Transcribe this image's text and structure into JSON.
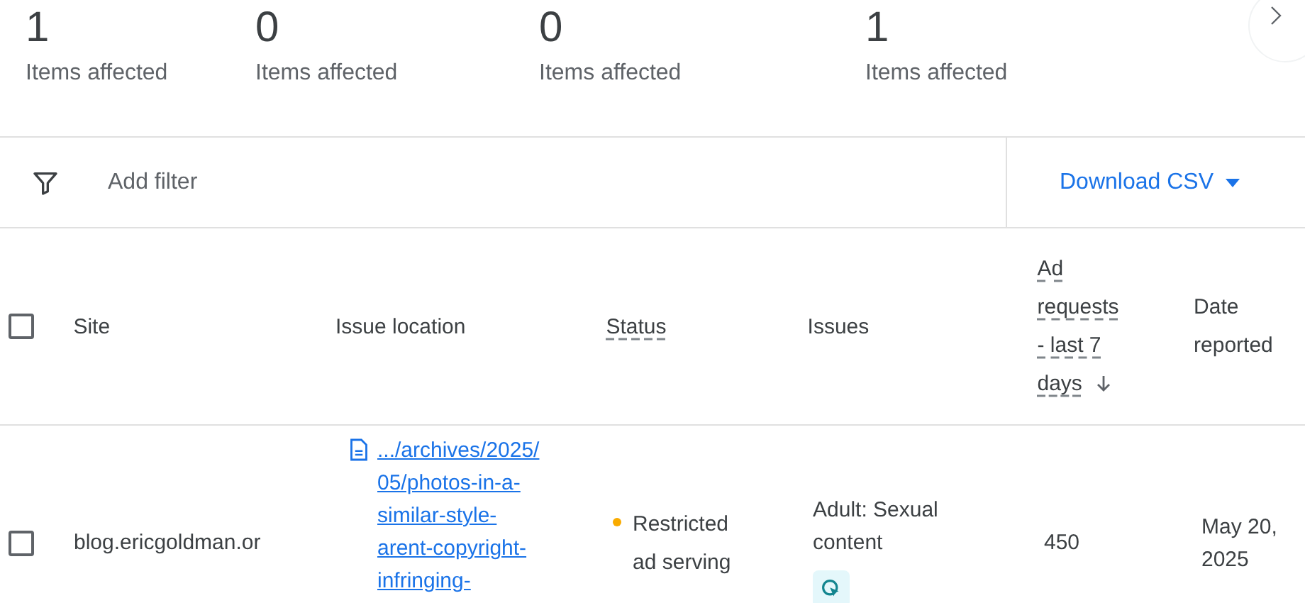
{
  "summary_cards": [
    {
      "count": "1",
      "label": "Items affected"
    },
    {
      "count": "0",
      "label": "Items affected"
    },
    {
      "count": "0",
      "label": "Items affected"
    },
    {
      "count": "1",
      "label": "Items affected"
    }
  ],
  "filter_bar": {
    "placeholder": "Add filter",
    "download_button": "Download CSV"
  },
  "table": {
    "select_all": {
      "checked": false
    },
    "columns": [
      {
        "label": "Site",
        "dashed": false,
        "sorted": false
      },
      {
        "label": "Issue location",
        "dashed": false,
        "sorted": false
      },
      {
        "label": "Status",
        "dashed": true,
        "sorted": false
      },
      {
        "label": "Issues",
        "dashed": false,
        "sorted": false
      },
      {
        "label": "Ad requests - last 7 days",
        "dashed": true,
        "sorted": true
      },
      {
        "label": "Date reported",
        "dashed": false,
        "sorted": false
      }
    ],
    "rows": [
      {
        "checked": false,
        "site": "blog.ericgoldman.or",
        "issue_location": ".../archives/2025/05/photos-in-a-similar-style-arent-copyright-infringing-",
        "status": "Restricted ad serving",
        "color": "#f9ab00",
        "issues": "Adult: Sexual content",
        "ad_requests": "450",
        "date_reported": "May 20, 2025"
      }
    ]
  }
}
